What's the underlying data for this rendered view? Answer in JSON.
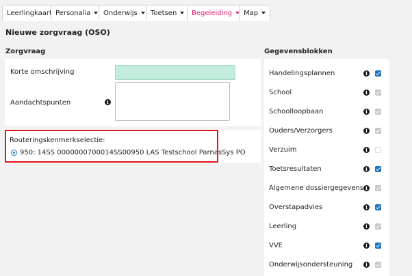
{
  "tabs": [
    {
      "label": "Leerlingkaart",
      "dropdown": false,
      "active": false
    },
    {
      "label": "Personalia",
      "dropdown": true,
      "active": false
    },
    {
      "label": "Onderwijs",
      "dropdown": true,
      "active": false
    },
    {
      "label": "Toetsen",
      "dropdown": true,
      "active": false
    },
    {
      "label": "Begeleiding",
      "dropdown": true,
      "active": true
    },
    {
      "label": "Map",
      "dropdown": true,
      "active": false
    }
  ],
  "page_title": "Nieuwe zorgvraag (OSO)",
  "zorgvraag": {
    "heading": "Zorgvraag",
    "korte_omschrijving_label": "Korte omschrijving",
    "korte_omschrijving_value": "",
    "aandachtspunten_label": "Aandachtspunten",
    "aandachtspunten_value": ""
  },
  "routering": {
    "label": "Routeringskenmerkselectie:",
    "option_label": "950: 14SS 0000000700014SS00950 LAS Testschool ParnasSys PO",
    "selected": true
  },
  "gegevensblokken": {
    "heading": "Gegevensblokken",
    "items": [
      {
        "label": "Handelingsplannen",
        "checked": true,
        "disabled": false
      },
      {
        "label": "School",
        "checked": true,
        "disabled": true
      },
      {
        "label": "Schoolloopbaan",
        "checked": true,
        "disabled": true
      },
      {
        "label": "Ouders/Verzorgers",
        "checked": true,
        "disabled": true
      },
      {
        "label": "Verzuim",
        "checked": false,
        "disabled": true
      },
      {
        "label": "Toetsresultaten",
        "checked": true,
        "disabled": false
      },
      {
        "label": "Algemene dossiergegevens",
        "checked": true,
        "disabled": true
      },
      {
        "label": "Overstapadvies",
        "checked": true,
        "disabled": false
      },
      {
        "label": "Leerling",
        "checked": true,
        "disabled": true
      },
      {
        "label": "VVE",
        "checked": true,
        "disabled": false
      },
      {
        "label": "Onderwijsondersteuning",
        "checked": true,
        "disabled": true
      }
    ]
  },
  "icons": {
    "info": "info-icon",
    "dropdown": "caret-down-icon"
  },
  "colors": {
    "active_tab": "#e0206f",
    "checkbox": "#1e73be",
    "highlight_box": "#e01515",
    "input_bg": "#c4ecdd"
  }
}
